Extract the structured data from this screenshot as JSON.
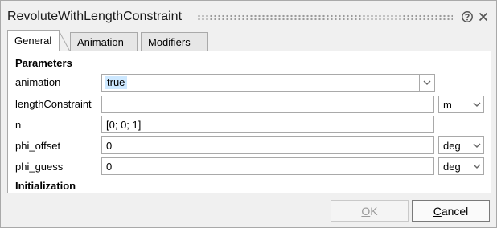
{
  "dialog": {
    "title": "RevoluteWithLengthConstraint"
  },
  "tabs": [
    {
      "label": "General",
      "active": true
    },
    {
      "label": "Animation",
      "active": false
    },
    {
      "label": "Modifiers",
      "active": false
    }
  ],
  "sections": {
    "parameters": "Parameters",
    "initialization": "Initialization"
  },
  "fields": {
    "animation": {
      "label": "animation",
      "value": "true"
    },
    "lengthConstraint": {
      "label": "lengthConstraint",
      "value": "",
      "unit": "m"
    },
    "n": {
      "label": "n",
      "value": "[0; 0; 1]"
    },
    "phi_offset": {
      "label": "phi_offset",
      "value": "0",
      "unit": "deg"
    },
    "phi_guess": {
      "label": "phi_guess",
      "value": "0",
      "unit": "deg"
    }
  },
  "buttons": {
    "ok": {
      "first": "O",
      "rest": "K",
      "enabled": false
    },
    "cancel": {
      "first": "C",
      "rest": "ancel",
      "enabled": true
    }
  },
  "icons": {
    "help": "help-icon",
    "close": "close-icon",
    "dropdown": "chevron-down-icon"
  },
  "colors": {
    "selection": "#cde8ff",
    "dialog_bg": "#f0f0f0",
    "border": "#a9a9a9"
  }
}
